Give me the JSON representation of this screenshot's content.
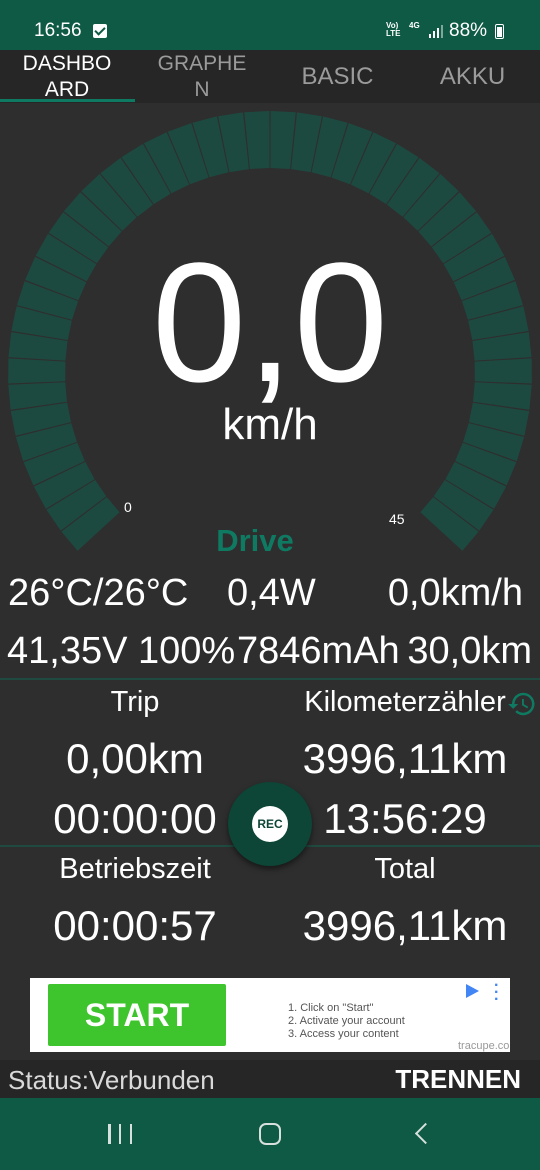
{
  "status_bar": {
    "time": "16:56",
    "network": "Vo) LTE",
    "network_type": "4G",
    "battery": "88%"
  },
  "tabs": [
    {
      "label": "DASHBO ARD",
      "active": true
    },
    {
      "label": "GRAPHE N",
      "active": false
    },
    {
      "label": "BASIC",
      "active": false
    },
    {
      "label": "AKKU",
      "active": false
    }
  ],
  "gauge": {
    "speed": "0,0",
    "unit": "km/h",
    "min": "0",
    "max": "45",
    "mode": "Drive",
    "level": 0
  },
  "stats": {
    "temperature": "26°C/26°C",
    "power": "0,4W",
    "speed": "0,0km/h",
    "voltage_percent": "41,35V 100%",
    "capacity": "7846mAh",
    "range": "30,0km"
  },
  "trip": {
    "label": "Trip",
    "distance": "0,00km",
    "time": "00:00:00"
  },
  "odometer": {
    "label": "Kilometerzähler",
    "distance": "3996,11km",
    "time": "13:56:29"
  },
  "runtime": {
    "label": "Betriebszeit",
    "time": "00:00:57"
  },
  "total": {
    "label": "Total",
    "distance": "3996,11km"
  },
  "rec_button": {
    "label": "REC"
  },
  "ad": {
    "button": "START",
    "step1": "1. Click on \"Start\"",
    "step2": "2. Activate your account",
    "step3": "3. Access your content",
    "source": "tracupe.co"
  },
  "connection": {
    "status": "Status:Verbunden",
    "action": "TRENNEN"
  },
  "colors": {
    "accent": "#0f7a62",
    "bar": "#0f5a45",
    "background": "#2e2e2e",
    "gauge_ticks": "#1d4a40"
  }
}
